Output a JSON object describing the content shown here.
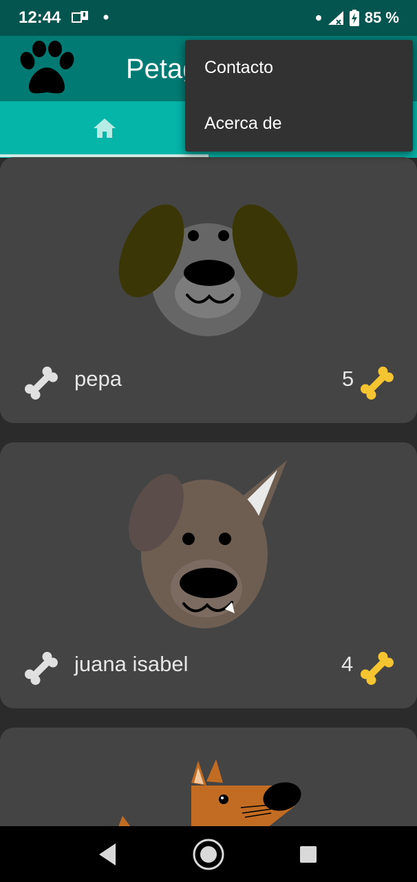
{
  "status_bar": {
    "time": "12:44",
    "battery_percent": "85 %",
    "icons": [
      "sim-notification-icon",
      "dot-icon",
      "signal-icon",
      "battery-icon"
    ]
  },
  "app_bar": {
    "title": "Petagram",
    "logo_icon": "paw-icon"
  },
  "tabs": [
    {
      "icon": "home-icon",
      "selected": true
    }
  ],
  "overflow_menu": {
    "items": [
      {
        "label": "Contacto"
      },
      {
        "label": "Acerca de"
      }
    ]
  },
  "pets": [
    {
      "name": "pepa",
      "likes": "5",
      "image": "dog-floppy-ears"
    },
    {
      "name": "juana isabel",
      "likes": "4",
      "image": "dog-pointy-ear"
    },
    {
      "name": "",
      "likes": "",
      "image": "dog-brown"
    }
  ],
  "colors": {
    "status_bar": "#04544f",
    "app_bar": "#007a73",
    "tab_bar": "#05b5a8",
    "card": "#444444",
    "background": "#2b2b2b",
    "menu": "#323232",
    "gold_bone": "#f5c431"
  },
  "nav_bar": {
    "icons": [
      "back-icon",
      "home-circle-icon",
      "recents-icon"
    ]
  }
}
